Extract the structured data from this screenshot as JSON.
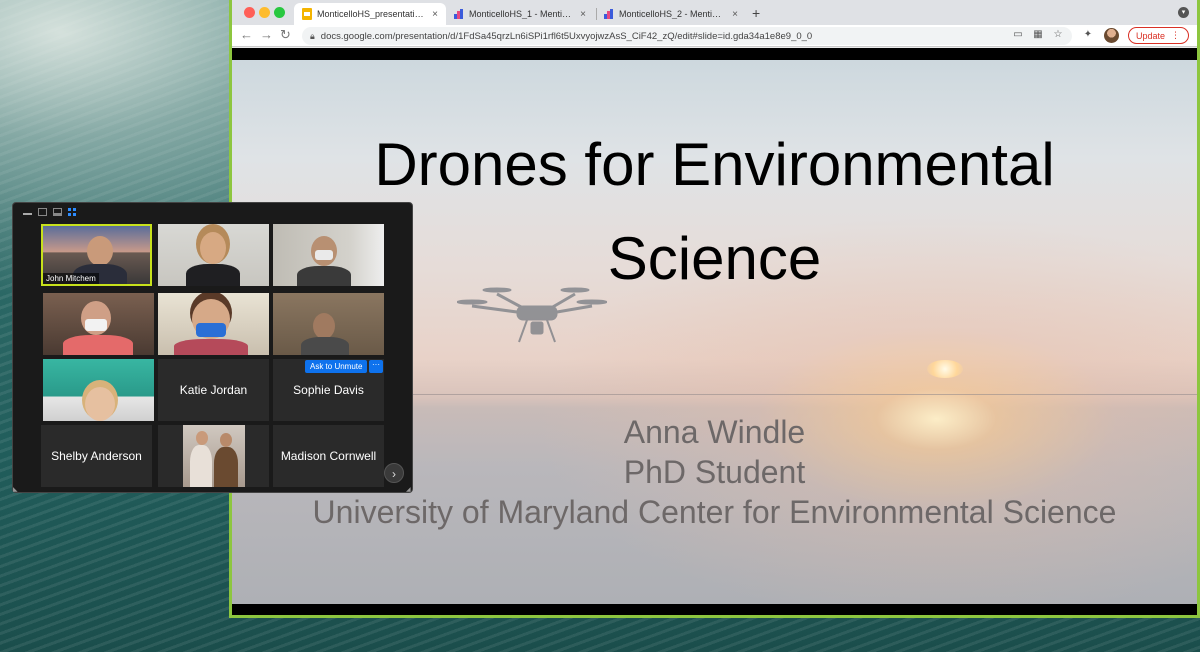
{
  "browser": {
    "tabs": [
      {
        "label": "MonticelloHS_presentation - G",
        "active": true,
        "icon": "google-slides-icon"
      },
      {
        "label": "MonticelloHS_1 - Mentimeter",
        "active": false,
        "icon": "mentimeter-icon"
      },
      {
        "label": "MonticelloHS_2 - Mentimeter",
        "active": false,
        "icon": "mentimeter-icon"
      }
    ],
    "tab_close": "×",
    "new_tab": "+",
    "url": "docs.google.com/presentation/d/1FdSa45qrzLn6iSPi1rfl6t5UxvyojwzAsS_CiF42_zQ/edit#slide=id.gda34a1e8e9_0_0",
    "update_label": "Update",
    "accent_color": "#8dc63f"
  },
  "slide": {
    "title_line1": "Drones for Environmental",
    "title_line2": "Science",
    "presenter_name": "Anna Windle",
    "presenter_role": "PhD Student",
    "presenter_affiliation": "University of Maryland Center for Environmental Science"
  },
  "zoom": {
    "participants": [
      {
        "name": "John Mitchem",
        "video": true,
        "active_speaker": true
      },
      {
        "name": "",
        "video": true
      },
      {
        "name": "",
        "video": true
      },
      {
        "name": "",
        "video": true
      },
      {
        "name": "",
        "video": true
      },
      {
        "name": "",
        "video": true
      },
      {
        "name": "",
        "video": true
      },
      {
        "name": "Katie Jordan",
        "video": false
      },
      {
        "name": "Sophie Davis",
        "video": false
      },
      {
        "name": "Shelby Anderson",
        "video": false
      },
      {
        "name": "",
        "video": true
      },
      {
        "name": "Madison Cornwell",
        "video": false
      }
    ],
    "ask_to_unmute": "Ask to Unmute",
    "more_label": "···",
    "next_page": "›"
  }
}
